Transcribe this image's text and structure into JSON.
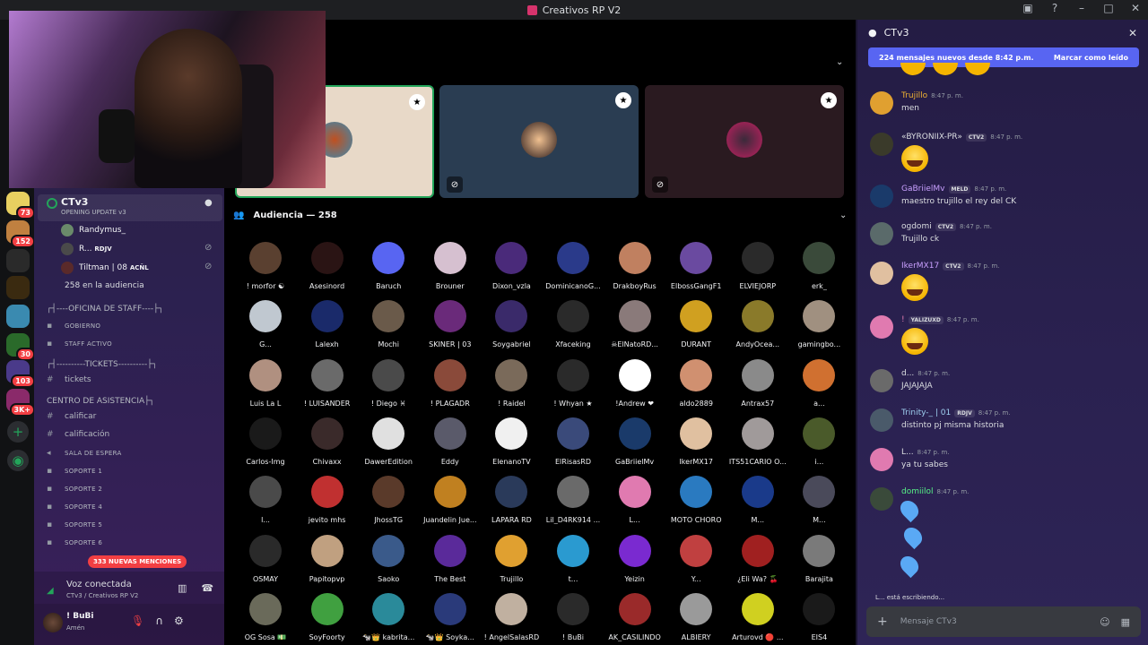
{
  "window": {
    "title": "Creativos RP V2"
  },
  "titlebar_icons": [
    "inbox-icon",
    "help-icon",
    "minimize-icon",
    "maximize-icon",
    "close-icon"
  ],
  "rail": {
    "badges": [
      "73",
      "152",
      "30",
      "103",
      "3K+"
    ]
  },
  "sidebar": {
    "voice_channel": {
      "name": "CTv3",
      "subtitle": "OPENING UPDATE v3"
    },
    "users": [
      {
        "name": "Randymus_",
        "tag": ""
      },
      {
        "name": "R...",
        "tag": "RDJV"
      },
      {
        "name": "Tiltman | 08",
        "tag": "ACÑL"
      }
    ],
    "audience_line": "258 en la audiencia",
    "categories": [
      {
        "label": "┌┤----OFICINA DE STAFF----├┐"
      },
      {
        "label": "┌┤----------TICKETS----------├┐"
      },
      {
        "label": "CENTRO DE ASISTENCIA├┐"
      }
    ],
    "channels": [
      {
        "label": "GOBIERNO"
      },
      {
        "label": "STAFF ACTIVO"
      },
      {
        "label": "tickets"
      },
      {
        "label": "calificar"
      },
      {
        "label": "calificación"
      },
      {
        "label": "SALA DE ESPERA"
      },
      {
        "label": "SOPORTE 1"
      },
      {
        "label": "SOPORTE 2"
      },
      {
        "label": "SOPORTE 4"
      },
      {
        "label": "SOPORTE 5"
      },
      {
        "label": "SOPORTE 6"
      }
    ],
    "mentions": "333 NUEVAS MENCIONES",
    "voice_connected": {
      "title": "Voz conectada",
      "subtitle": "CTv3 / Creativos RP V2"
    },
    "user": {
      "name": "! BuBi",
      "status": "Amén"
    }
  },
  "stage": {
    "audience_header": "Audiencia — 258",
    "speakers": [
      {
        "color": "#e8d9c8"
      },
      {
        "color": "#2a3d52"
      },
      {
        "color": "#2a1a20"
      }
    ]
  },
  "audience": [
    {
      "name": "! morfor ☯",
      "color": "#5a4030"
    },
    {
      "name": "Asesinord",
      "color": "#2a1414"
    },
    {
      "name": "Baruch",
      "color": "#5865f2"
    },
    {
      "name": "Brouner",
      "color": "#d6c0d0"
    },
    {
      "name": "Dixon_vzla",
      "color": "#4a2a7a"
    },
    {
      "name": "DominicanoG...",
      "color": "#2a3a8a"
    },
    {
      "name": "DrakboyRus",
      "color": "#c08060"
    },
    {
      "name": "ElbossGangF1",
      "color": "#6a4aa0"
    },
    {
      "name": "ELVIEJORP",
      "color": "#2a2a2a"
    },
    {
      "name": "erk_",
      "color": "#3a4a3a"
    },
    {
      "name": "G...",
      "color": "#c0c8d0"
    },
    {
      "name": "Lalexh",
      "color": "#1a2a6a"
    },
    {
      "name": "Mochi",
      "color": "#6a5a4a"
    },
    {
      "name": "SKINER | 03",
      "color": "#6a2a7a"
    },
    {
      "name": "Soygabriel",
      "color": "#3a2a6a"
    },
    {
      "name": "Xfaceking",
      "color": "#2a2a2a"
    },
    {
      "name": "☠ElNatoRD...",
      "color": "#8a7a7a"
    },
    {
      "name": "DURANT",
      "color": "#d0a020"
    },
    {
      "name": "AndyOcea...",
      "color": "#8a7a2a"
    },
    {
      "name": "gamingbo...",
      "color": "#a09080"
    },
    {
      "name": "Luis La L",
      "color": "#b09080"
    },
    {
      "name": "! LUISANDER",
      "color": "#6a6a6a"
    },
    {
      "name": "! Diego ♓",
      "color": "#4a4a4a"
    },
    {
      "name": "! PLAGADR",
      "color": "#8a4a3a"
    },
    {
      "name": "! Raidel",
      "color": "#7a6a5a"
    },
    {
      "name": "! Whyan ★",
      "color": "#2a2a2a"
    },
    {
      "name": "!Andrew ❤",
      "color": "#ffffff"
    },
    {
      "name": "aldo2889",
      "color": "#d09070"
    },
    {
      "name": "Antrax57",
      "color": "#8a8a8a"
    },
    {
      "name": "a...",
      "color": "#d07030"
    },
    {
      "name": "Carlos-Img",
      "color": "#1a1a1a"
    },
    {
      "name": "Chivaxx",
      "color": "#3a2a2a"
    },
    {
      "name": "DawerEdition",
      "color": "#e0e0e0"
    },
    {
      "name": "Eddy",
      "color": "#5a5a6a"
    },
    {
      "name": "ElenanoTV",
      "color": "#f0f0f0"
    },
    {
      "name": "ElRisasRD",
      "color": "#3a4a7a"
    },
    {
      "name": "GaBriielMv",
      "color": "#1a3a6a"
    },
    {
      "name": "IkerMX17",
      "color": "#e0c0a0"
    },
    {
      "name": "ITS51CARIO O...",
      "color": "#a09a9a"
    },
    {
      "name": "i...",
      "color": "#4a5a2a"
    },
    {
      "name": "l...",
      "color": "#4a4a4a"
    },
    {
      "name": "jevito mhs",
      "color": "#c03030"
    },
    {
      "name": "JhossTG",
      "color": "#5a3a2a"
    },
    {
      "name": "Juandelin Jue...",
      "color": "#c08020"
    },
    {
      "name": "LAPARA RD",
      "color": "#2a3a5a"
    },
    {
      "name": "Lil_D4RK914 ...",
      "color": "#6a6a6a"
    },
    {
      "name": "L...",
      "color": "#e07ab0"
    },
    {
      "name": "MOTO CHORO",
      "color": "#2a7ac0"
    },
    {
      "name": "M...",
      "color": "#1a3a8a"
    },
    {
      "name": "M...",
      "color": "#4a4a5a"
    },
    {
      "name": "OSMAY",
      "color": "#2a2a2a"
    },
    {
      "name": "Papitopvp",
      "color": "#c0a080"
    },
    {
      "name": "Saoko",
      "color": "#3a5a8a"
    },
    {
      "name": "The Best",
      "color": "#5a2a9a"
    },
    {
      "name": "Trujillo",
      "color": "#e0a030"
    },
    {
      "name": "t...",
      "color": "#2a9ad0"
    },
    {
      "name": "Yeizin",
      "color": "#7a2ad0"
    },
    {
      "name": "Y...",
      "color": "#c04040"
    },
    {
      "name": "¿Eli Wa? 🍒",
      "color": "#a02020"
    },
    {
      "name": "Barajita",
      "color": "#7a7a7a"
    },
    {
      "name": "OG Sosa 💵",
      "color": "#6a6a5a"
    },
    {
      "name": "SoyFoorty",
      "color": "#40a040"
    },
    {
      "name": "🐄👑 kabrita...",
      "color": "#2a8a9a"
    },
    {
      "name": "🐄👑 Soyka...",
      "color": "#2a3a7a"
    },
    {
      "name": "! AngelSalasRD",
      "color": "#c0b0a0"
    },
    {
      "name": "! BuBi",
      "color": "#2a2a2a"
    },
    {
      "name": "AK_CASILINDO",
      "color": "#9a2a2a"
    },
    {
      "name": "ALBIERY",
      "color": "#9a9a9a"
    },
    {
      "name": "Arturovd 🔴 ...",
      "color": "#d0d020"
    },
    {
      "name": "EIS4",
      "color": "#1a1a1a"
    }
  ],
  "chat": {
    "title": "CTv3",
    "new_messages": "224 mensajes nuevos desde 8:42 p.m.",
    "mark_read": "Marcar como leído",
    "messages": [
      {
        "author": "Trujillo",
        "color": "#f0b232",
        "time": "8:47 p. m.",
        "tag": "",
        "text": "men",
        "emoji": false,
        "av": "#e0a030"
      },
      {
        "author": "«BYRONIIX-PR»",
        "color": "#dbdee1",
        "time": "8:47 p. m.",
        "tag": "CTV2",
        "text": "",
        "emoji": true,
        "av": "#3a3a2a"
      },
      {
        "author": "GaBriielMv",
        "color": "#c9a0ff",
        "time": "8:47 p. m.",
        "tag": "MELD",
        "text": "maestro trujillo el rey del CK",
        "emoji": false,
        "av": "#1a3a6a"
      },
      {
        "author": "ogdomi",
        "color": "#dbdee1",
        "time": "8:47 p. m.",
        "tag": "CTV2",
        "text": "Trujillo ck",
        "emoji": false,
        "av": "#5a6a6a"
      },
      {
        "author": "IkerMX17",
        "color": "#c9a0ff",
        "time": "8:47 p. m.",
        "tag": "CTV2",
        "text": "",
        "emoji": true,
        "av": "#e0c0a0"
      },
      {
        "author": "!",
        "color": "#e07ab0",
        "time": "8:47 p. m.",
        "tag": "YALIZUXD",
        "text": "",
        "emoji": true,
        "av": "#e07ab0"
      },
      {
        "author": "d...",
        "color": "#dbdee1",
        "time": "8:47 p. m.",
        "tag": "",
        "text": "JAJAJAJA",
        "emoji": false,
        "av": "#6a6a6a"
      },
      {
        "author": "Trinity-_ | 01",
        "color": "#9fd0f0",
        "time": "8:47 p. m.",
        "tag": "RDJV",
        "text": "distinto pj misma historia",
        "emoji": false,
        "av": "#4a5a6a"
      },
      {
        "author": "L...",
        "color": "#dbdee1",
        "time": "8:47 p. m.",
        "tag": "",
        "text": "ya tu sabes",
        "emoji": false,
        "av": "#e07ab0"
      },
      {
        "author": "domiilol",
        "color": "#57f287",
        "time": "8:47 p. m.",
        "tag": "",
        "text": "",
        "emoji": false,
        "av": "#3a4a3a"
      }
    ],
    "typing": "L... está escribiendo...",
    "input_placeholder": "Mensaje CTv3"
  }
}
